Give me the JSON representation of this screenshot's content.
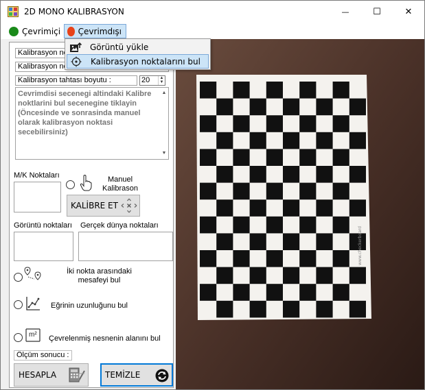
{
  "window": {
    "title": "2D MONO KALIBRASYON",
    "minimize_glyph": "—",
    "maximize_glyph": "☐",
    "close_glyph": "✕"
  },
  "menu": {
    "online": {
      "label": "Çevrimiçi",
      "color": "#1a8a1a"
    },
    "offline": {
      "label": "Çevrimdışı",
      "color": "#e8431a"
    },
    "dropdown": [
      {
        "label": "Görüntü yükle",
        "icon": "image-upload-icon"
      },
      {
        "label": "Kalibrasyon noktalarını bul",
        "icon": "target-icon"
      }
    ]
  },
  "left": {
    "field1": "Kalibrasyon no",
    "field2": "Kalibrasyon no",
    "board_size_label": "Kalibrasyon tahtası boyutu :",
    "board_size_value": "20",
    "instructions": "Cevrimdisi secenegi altindaki Kalibre noktlarini bul secenegine tiklayin (Öncesinde ve sonrasinda manuel olarak kalibrasyon noktasi secebilirsiniz)",
    "mk_points_label": "M/K Noktaları",
    "manual_calibration_label": "Manuel Kalibrason",
    "calibrate_button": "KALİBRE ET",
    "image_points_label": "Görüntü noktaları",
    "world_points_label": "Gerçek dünya noktaları",
    "option_distance": "İki nokta arasındaki mesafeyi bul",
    "option_curve": "Eğrinin uzunluğunu bul",
    "option_area": "Çevrelenmiş nesnenin alanını bul",
    "area_icon_text": "m²",
    "result_label": "Ölçüm sonucu :",
    "calculate_button": "HESAPLA",
    "clear_button": "TEMİZLE"
  },
  "image": {
    "checkerboard": {
      "cols": 10,
      "rows": 14
    },
    "side_text": "www.checkerboard"
  }
}
